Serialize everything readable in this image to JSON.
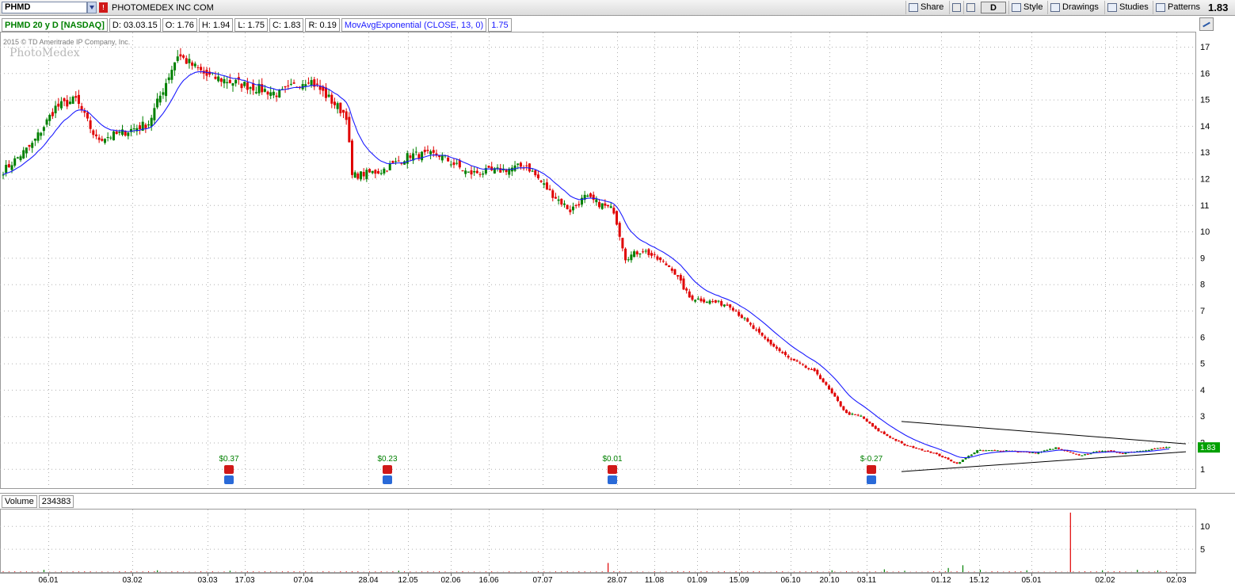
{
  "toolbar": {
    "symbol": "PHMD",
    "flag": "!",
    "company": "PHOTOMEDEX INC COM",
    "share_label": "Share",
    "aggregation_label": "D",
    "style_label": "Style",
    "drawings_label": "Drawings",
    "studies_label": "Studies",
    "patterns_label": "Patterns",
    "last_price": "1.83"
  },
  "infobar": {
    "symbol_label": "PHMD 20 y D [NASDAQ]",
    "date": "D: 03.03.15",
    "open": "O: 1.76",
    "high": "H: 1.94",
    "low": "L: 1.75",
    "close": "C: 1.83",
    "range": "R: 0.19",
    "study_label": "MovAvgExponential (CLOSE, 13, 0)",
    "study_value": "1.75"
  },
  "copyright": "2015 © TD Ameritrade IP Company, Inc.",
  "watermark": "PhotoMedex",
  "volume_panel": {
    "label": "Volume",
    "value": "234383"
  },
  "colors": {
    "up": "#008000",
    "down": "#e00000",
    "ema": "#1a1aff",
    "grid": "#b0b0b0",
    "trendline": "#000000",
    "price_badge": "#00a000"
  },
  "chart_data": [
    {
      "type": "candlestick",
      "title": "",
      "ylim": [
        0.6,
        17.6
      ],
      "yticks": [
        1,
        2,
        3,
        4,
        5,
        6,
        7,
        8,
        9,
        10,
        11,
        12,
        13,
        14,
        15,
        16,
        17
      ],
      "xlabels": [
        "06.01",
        "03.02",
        "03.03",
        "17.03",
        "07.04",
        "28.04",
        "12.05",
        "02.06",
        "16.06",
        "07.07",
        "28.07",
        "11.08",
        "01.09",
        "15.09",
        "06.10",
        "20.10",
        "03.11",
        "01.12",
        "15.12",
        "05.01",
        "02.02",
        "02.03"
      ],
      "grid": true,
      "last_price_badge": "1.83",
      "close_anchors": [
        [
          0,
          12.3
        ],
        [
          10,
          13.3
        ],
        [
          18,
          14.7
        ],
        [
          25,
          15.0
        ],
        [
          32,
          13.5
        ],
        [
          40,
          13.7
        ],
        [
          50,
          14.1
        ],
        [
          60,
          16.7
        ],
        [
          70,
          15.9
        ],
        [
          85,
          15.5
        ],
        [
          95,
          15.2
        ],
        [
          105,
          15.8
        ],
        [
          118,
          14.4
        ],
        [
          120,
          12.1
        ],
        [
          130,
          12.3
        ],
        [
          140,
          12.9
        ],
        [
          150,
          12.9
        ],
        [
          160,
          12.2
        ],
        [
          170,
          12.3
        ],
        [
          180,
          12.5
        ],
        [
          188,
          11.5
        ],
        [
          195,
          10.8
        ],
        [
          200,
          11.3
        ],
        [
          210,
          10.8
        ],
        [
          214,
          9.0
        ],
        [
          220,
          9.3
        ],
        [
          230,
          8.6
        ],
        [
          236,
          7.5
        ],
        [
          250,
          7.2
        ],
        [
          260,
          6.1
        ],
        [
          270,
          5.2
        ],
        [
          280,
          4.6
        ],
        [
          290,
          3.1
        ],
        [
          295,
          3.0
        ],
        [
          300,
          2.5
        ],
        [
          310,
          1.9
        ],
        [
          320,
          1.6
        ],
        [
          328,
          1.2
        ],
        [
          335,
          1.7
        ],
        [
          345,
          1.7
        ],
        [
          355,
          1.6
        ],
        [
          362,
          1.8
        ],
        [
          370,
          1.5
        ],
        [
          378,
          1.7
        ],
        [
          385,
          1.6
        ],
        [
          395,
          1.75
        ],
        [
          401,
          1.83
        ]
      ],
      "ema": {
        "name": "MovAvgExponential (CLOSE, 13, 0)",
        "period": 13
      },
      "dividends": [
        {
          "label": "$0.37",
          "date": "17.03"
        },
        {
          "label": "$0.23",
          "date": "12.05"
        },
        {
          "label": "$0.01",
          "date": "28.07"
        },
        {
          "label": "$-0.27",
          "date": "03.11"
        }
      ],
      "trendlines": [
        {
          "from": [
            "01.12",
            2.8
          ],
          "to": [
            "02.03",
            1.95
          ]
        },
        {
          "from": [
            "01.12",
            0.9
          ],
          "to": [
            "02.03",
            1.65
          ]
        }
      ]
    },
    {
      "type": "bar",
      "title": "Volume",
      "yticks": [
        5,
        10
      ],
      "ylim": [
        0,
        13.5
      ],
      "spikes": [
        [
          14,
          0.5
        ],
        [
          53,
          0.4
        ],
        [
          78,
          0.3
        ],
        [
          136,
          0.3
        ],
        [
          208,
          2.0
        ],
        [
          285,
          0.4
        ],
        [
          303,
          0.6
        ],
        [
          310,
          0.3
        ],
        [
          325,
          0.9
        ],
        [
          330,
          1.5
        ],
        [
          336,
          0.5
        ],
        [
          352,
          0.4
        ],
        [
          367,
          13.0
        ],
        [
          378,
          0.4
        ],
        [
          390,
          0.5
        ],
        [
          397,
          0.4
        ]
      ]
    }
  ]
}
